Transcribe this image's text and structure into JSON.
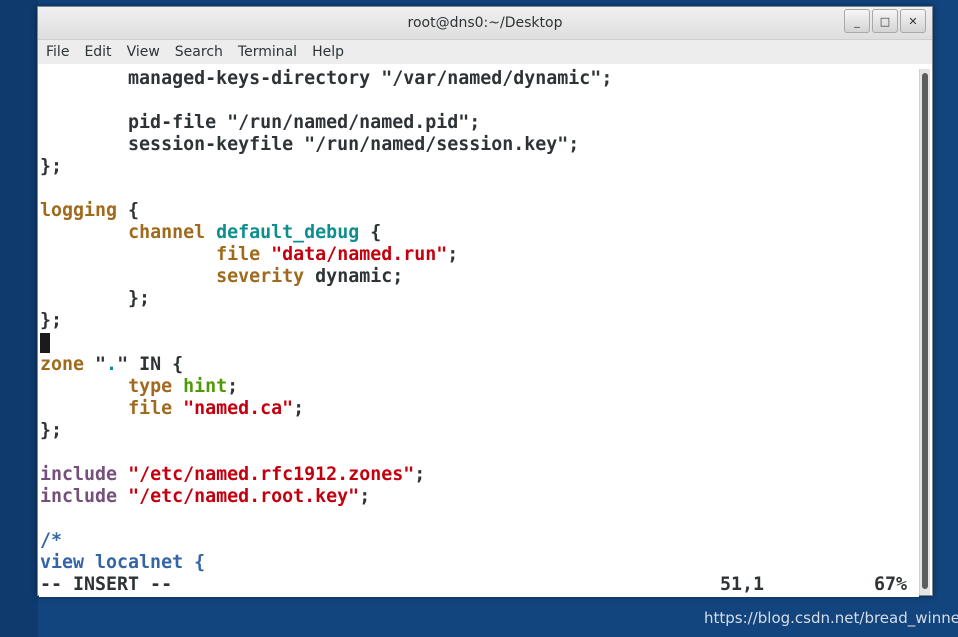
{
  "window": {
    "title": "root@dns0:~/Desktop",
    "controls": [
      "_",
      "□",
      "✕"
    ]
  },
  "menu": [
    "File",
    "Edit",
    "View",
    "Search",
    "Terminal",
    "Help"
  ],
  "colors": {
    "plain": "#2e3436",
    "keyword": "#a06a1d",
    "string": "#c4000f",
    "identifier": "#0e8f8f",
    "type": "#4e9a06",
    "include": "#75507b",
    "comment": "#3465a4"
  },
  "editor": {
    "lines": [
      [
        {
          "t": "        managed-keys-directory \"/var/named/dynamic\";",
          "c": "plain"
        }
      ],
      [
        {
          "t": "",
          "c": "plain"
        }
      ],
      [
        {
          "t": "        pid-file \"/run/named/named.pid\";",
          "c": "plain"
        }
      ],
      [
        {
          "t": "        session-keyfile \"/run/named/session.key\";",
          "c": "plain"
        }
      ],
      [
        {
          "t": "};",
          "c": "plain"
        }
      ],
      [
        {
          "t": "",
          "c": "plain"
        }
      ],
      [
        {
          "t": "logging",
          "c": "keyword"
        },
        {
          "t": " {",
          "c": "plain"
        }
      ],
      [
        {
          "t": "        ",
          "c": "plain"
        },
        {
          "t": "channel",
          "c": "keyword"
        },
        {
          "t": " ",
          "c": "plain"
        },
        {
          "t": "default_debug",
          "c": "identifier"
        },
        {
          "t": " {",
          "c": "plain"
        }
      ],
      [
        {
          "t": "                ",
          "c": "plain"
        },
        {
          "t": "file",
          "c": "keyword"
        },
        {
          "t": " ",
          "c": "plain"
        },
        {
          "t": "\"data/named.run\"",
          "c": "string"
        },
        {
          "t": ";",
          "c": "plain"
        }
      ],
      [
        {
          "t": "                ",
          "c": "plain"
        },
        {
          "t": "severity",
          "c": "keyword"
        },
        {
          "t": " dynamic;",
          "c": "plain"
        }
      ],
      [
        {
          "t": "        };",
          "c": "plain"
        }
      ],
      [
        {
          "t": "};",
          "c": "plain"
        }
      ],
      [
        {
          "t": "",
          "c": "cursor"
        }
      ],
      [
        {
          "t": "zone",
          "c": "keyword"
        },
        {
          "t": " \"",
          "c": "plain"
        },
        {
          "t": ".",
          "c": "identifier"
        },
        {
          "t": "\" IN {",
          "c": "plain"
        }
      ],
      [
        {
          "t": "        ",
          "c": "plain"
        },
        {
          "t": "type",
          "c": "keyword"
        },
        {
          "t": " ",
          "c": "plain"
        },
        {
          "t": "hint",
          "c": "type"
        },
        {
          "t": ";",
          "c": "plain"
        }
      ],
      [
        {
          "t": "        ",
          "c": "plain"
        },
        {
          "t": "file",
          "c": "keyword"
        },
        {
          "t": " ",
          "c": "plain"
        },
        {
          "t": "\"named.ca\"",
          "c": "string"
        },
        {
          "t": ";",
          "c": "plain"
        }
      ],
      [
        {
          "t": "};",
          "c": "plain"
        }
      ],
      [
        {
          "t": "",
          "c": "plain"
        }
      ],
      [
        {
          "t": "include",
          "c": "include"
        },
        {
          "t": " ",
          "c": "plain"
        },
        {
          "t": "\"/etc/named.rfc1912.zones\"",
          "c": "string"
        },
        {
          "t": ";",
          "c": "plain"
        }
      ],
      [
        {
          "t": "include",
          "c": "include"
        },
        {
          "t": " ",
          "c": "plain"
        },
        {
          "t": "\"/etc/named.root.key\"",
          "c": "string"
        },
        {
          "t": ";",
          "c": "plain"
        }
      ],
      [
        {
          "t": "",
          "c": "plain"
        }
      ],
      [
        {
          "t": "/*",
          "c": "comment"
        }
      ],
      [
        {
          "t": "view localnet {",
          "c": "comment"
        }
      ]
    ]
  },
  "statusline": {
    "mode": "-- INSERT --",
    "position": "51,1",
    "percent": "67%"
  },
  "watermark": "https://blog.csdn.net/bread_winner"
}
